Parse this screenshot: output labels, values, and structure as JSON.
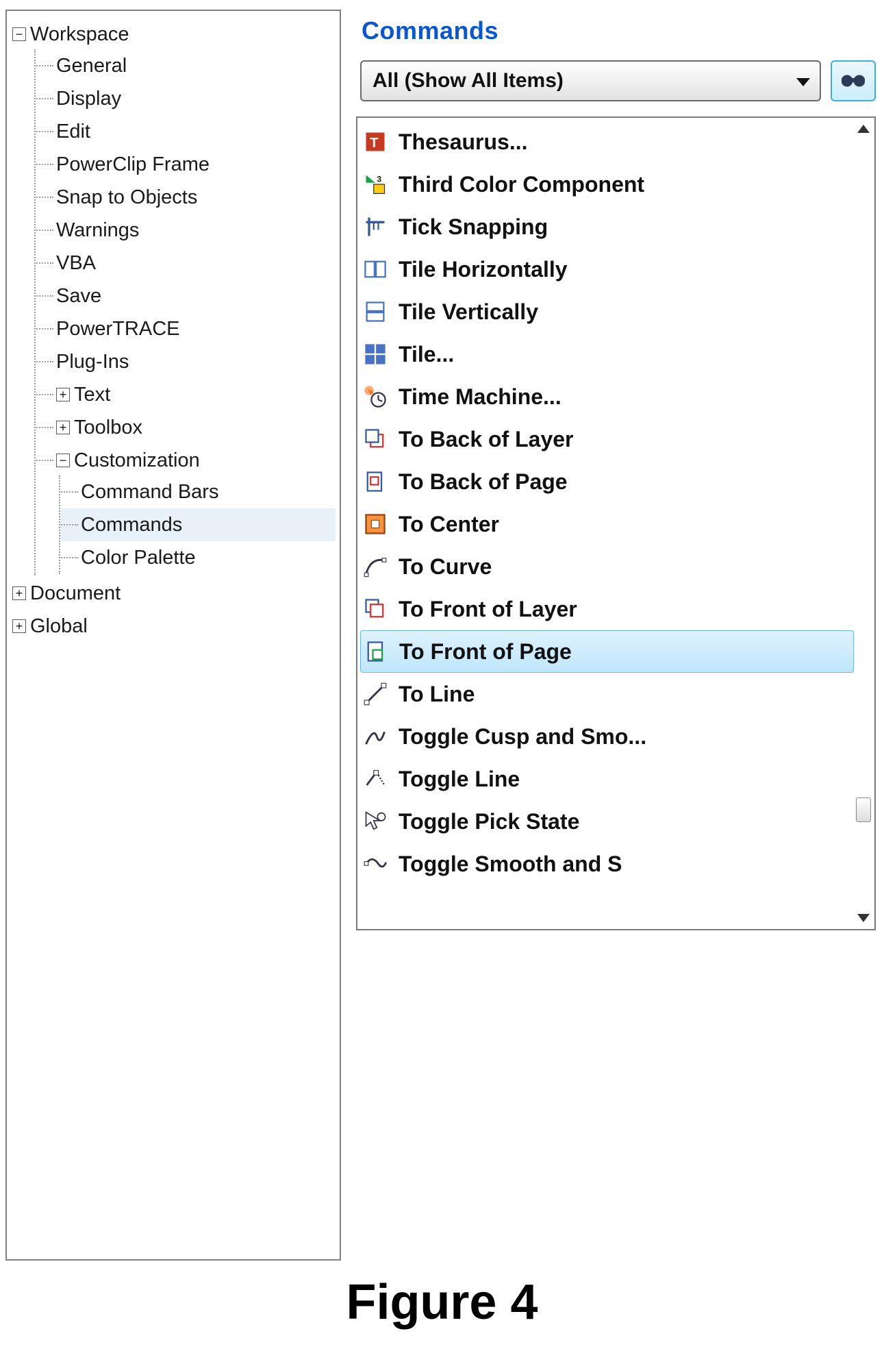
{
  "tree": {
    "workspace": {
      "label": "Workspace",
      "items": {
        "general": "General",
        "display": "Display",
        "edit": "Edit",
        "powerclip": "PowerClip Frame",
        "snap": "Snap to Objects",
        "warnings": "Warnings",
        "vba": "VBA",
        "save": "Save",
        "powertrace": "PowerTRACE",
        "plugins": "Plug-Ins",
        "text": "Text",
        "toolbox": "Toolbox",
        "customization": {
          "label": "Customization",
          "command_bars": "Command Bars",
          "commands": "Commands",
          "color_palette": "Color Palette"
        }
      }
    },
    "document": "Document",
    "global": "Global"
  },
  "panel": {
    "title": "Commands",
    "filter": "All (Show All Items)",
    "items": [
      {
        "icon": "thesaurus",
        "label": "Thesaurus..."
      },
      {
        "icon": "third-color",
        "label": "Third Color Component"
      },
      {
        "icon": "tick-snap",
        "label": "Tick Snapping"
      },
      {
        "icon": "tile-h",
        "label": "Tile Horizontally"
      },
      {
        "icon": "tile-v",
        "label": "Tile Vertically"
      },
      {
        "icon": "tile",
        "label": "Tile..."
      },
      {
        "icon": "time-machine",
        "label": "Time Machine..."
      },
      {
        "icon": "to-back-layer",
        "label": "To Back of Layer"
      },
      {
        "icon": "to-back-page",
        "label": "To Back of Page"
      },
      {
        "icon": "to-center",
        "label": "To Center"
      },
      {
        "icon": "to-curve",
        "label": "To Curve"
      },
      {
        "icon": "to-front-layer",
        "label": "To Front of Layer"
      },
      {
        "icon": "to-front-page",
        "label": "To Front of Page",
        "selected": true
      },
      {
        "icon": "to-line",
        "label": "To Line"
      },
      {
        "icon": "toggle-cusp",
        "label": "Toggle Cusp and Smo..."
      },
      {
        "icon": "toggle-line",
        "label": "Toggle Line"
      },
      {
        "icon": "toggle-pick",
        "label": "Toggle Pick State"
      },
      {
        "icon": "toggle-smooth",
        "label": "Toggle Smooth and S"
      }
    ]
  },
  "caption": "Figure 4"
}
